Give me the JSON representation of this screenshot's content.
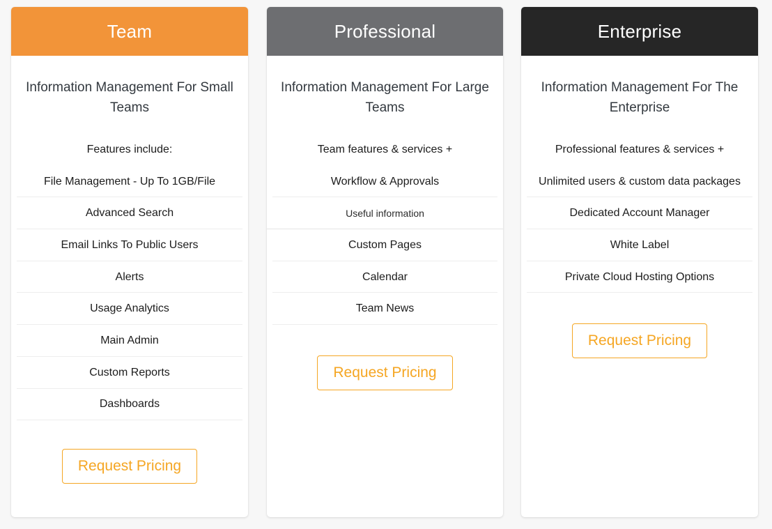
{
  "page": {
    "background_color": "#f7f7f7",
    "accent_color": "#f5a623"
  },
  "plans": [
    {
      "name": "Team",
      "header_color": "#f29439",
      "header_text_color": "#ffffff",
      "tagline": "Information Management For Small Teams",
      "lead_feature": "Features include:",
      "features": [
        "File Management - Up To 1GB/File",
        "Advanced Search",
        "Email Links To Public Users",
        "Alerts",
        "Usage Analytics",
        "Main Admin",
        "Custom Reports",
        "Dashboards"
      ],
      "cta_label": "Request Pricing"
    },
    {
      "name": "Professional",
      "header_color": "#6d6e71",
      "header_text_color": "#ffffff",
      "tagline": "Information Management For Large Teams",
      "lead_feature": "Team features & services +",
      "features": [
        "Workflow & Approvals",
        "Useful information",
        "Custom Pages",
        "Calendar",
        "Team News"
      ],
      "cta_label": "Request Pricing"
    },
    {
      "name": "Enterprise",
      "header_color": "#262626",
      "header_text_color": "#ffffff",
      "tagline": "Information Management For The Enterprise",
      "lead_feature": "Professional features & services +",
      "features": [
        "Unlimited users & custom data packages",
        "Dedicated Account Manager",
        "White Label",
        "Private Cloud Hosting Options"
      ],
      "cta_label": "Request Pricing"
    }
  ]
}
